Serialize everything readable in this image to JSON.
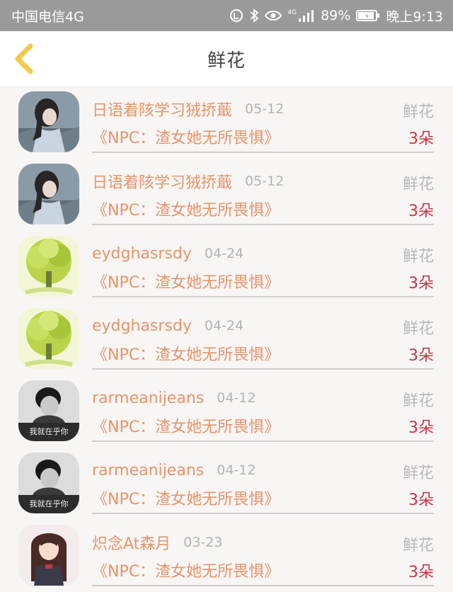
{
  "status_bar": {
    "carrier": "中国电信4G",
    "network_tag": "4G",
    "battery": "89%",
    "time": "晚上9:13",
    "icons": [
      "data-saver-icon",
      "bluetooth-icon",
      "eye-comfort-icon",
      "signal-icon",
      "battery-icon"
    ]
  },
  "nav": {
    "back_icon": "chevron-left-icon",
    "title": "鲜花",
    "accent": "#f2c94c"
  },
  "colors": {
    "name": "#e6956a",
    "count": "#c83646",
    "muted": "#b3b3b3"
  },
  "items": [
    {
      "avatar": "girl-photo",
      "name": "日语着陔学习狨挢蕺",
      "date": "05-12",
      "gift": "鲜花",
      "book": "《NPC：渣女她无所畏惧》",
      "count": "3朵"
    },
    {
      "avatar": "girl-photo",
      "name": "日语着陔学习狨挢蕺",
      "date": "05-12",
      "gift": "鲜花",
      "book": "《NPC：渣女她无所畏惧》",
      "count": "3朵"
    },
    {
      "avatar": "green-tree",
      "name": "eydghasrsdy",
      "date": "04-24",
      "gift": "鲜花",
      "book": "《NPC：渣女她无所畏惧》",
      "count": "3朵"
    },
    {
      "avatar": "green-tree",
      "name": "eydghasrsdy",
      "date": "04-24",
      "gift": "鲜花",
      "book": "《NPC：渣女她无所畏惧》",
      "count": "3朵"
    },
    {
      "avatar": "bw-boy-photo",
      "name": "rarmeanijeans",
      "date": "04-12",
      "gift": "鲜花",
      "book": "《NPC：渣女她无所畏惧》",
      "count": "3朵"
    },
    {
      "avatar": "bw-boy-photo",
      "name": "rarmeanijeans",
      "date": "04-12",
      "gift": "鲜花",
      "book": "《NPC：渣女她无所畏惧》",
      "count": "3朵"
    },
    {
      "avatar": "anime-girl",
      "name": "炽念At森月",
      "date": "03-23",
      "gift": "鲜花",
      "book": "《NPC：渣女她无所畏惧》",
      "count": "3朵"
    }
  ]
}
